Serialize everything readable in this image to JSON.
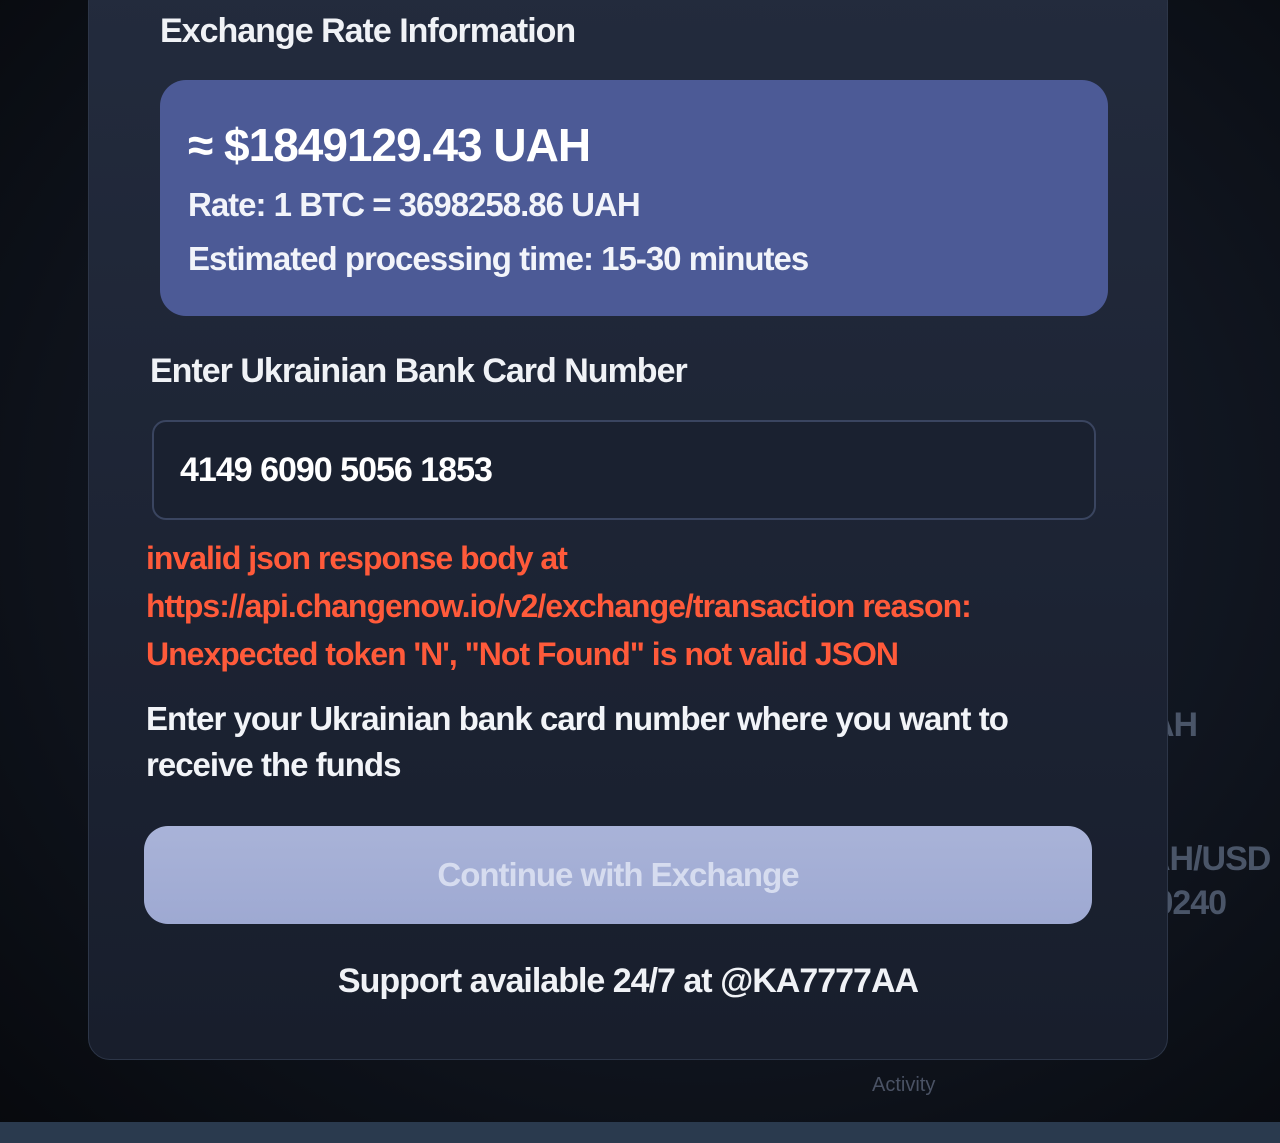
{
  "rate_section": {
    "title": "Exchange Rate Information",
    "amount": "≈ $1849129.43 UAH",
    "rate": "Rate: 1 BTC = 3698258.86 UAH",
    "processing_time": "Estimated processing time: 15-30 minutes"
  },
  "card_section": {
    "title": "Enter Ukrainian Bank Card Number",
    "card_number": "4149 6090 5056 1853",
    "error_message": "invalid json response body at https://api.changenow.io/v2/exchange/transaction reason: Unexpected token 'N', \"Not Found\" is not valid JSON",
    "hint": "Enter your Ukrainian bank card number where you want to receive the funds"
  },
  "continue_button": "Continue with Exchange",
  "support_text": "Support available 24/7 at @KA7777AA",
  "background": {
    "right_label_1": "AH",
    "right_label_2": "AH/USD",
    "right_label_3": ".0240",
    "nav_label": "Activity"
  },
  "colors": {
    "rate_card": "#4c5a96",
    "error": "#ff5a3a",
    "button": "#a9b3d8"
  }
}
